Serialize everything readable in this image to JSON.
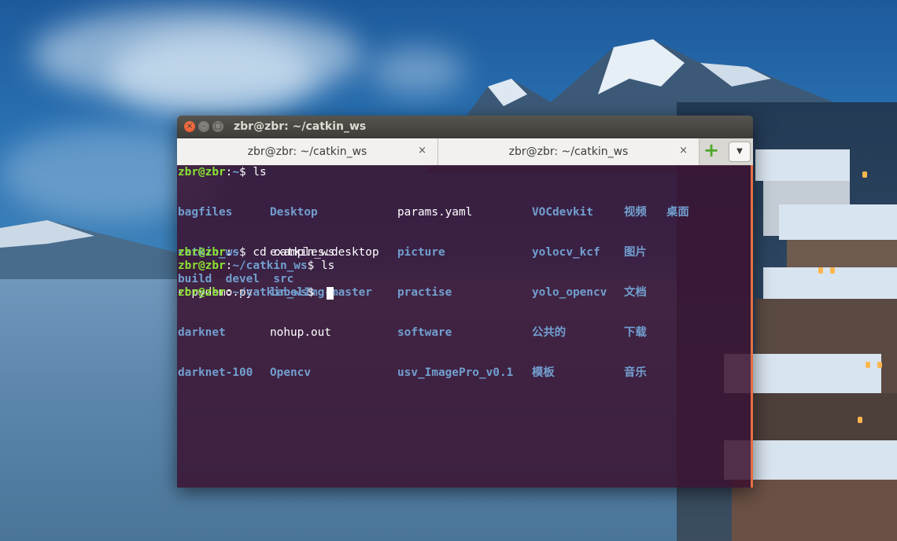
{
  "window": {
    "title": "zbr@zbr: ~/catkin_ws",
    "close_icon": "×",
    "minimize_icon": "–",
    "maximize_icon": "□"
  },
  "tabs": [
    {
      "label": "zbr@zbr: ~/catkin_ws",
      "close": "×"
    },
    {
      "label": "zbr@zbr: ~/catkin_ws",
      "close": "×"
    }
  ],
  "tabbar": {
    "new_tab_icon": "+",
    "menu_icon": "▼"
  },
  "terminal": {
    "user_host": "zbr@zbr",
    "colon": ":",
    "prompt_home": "~",
    "prompt_ws": "~/catkin_ws",
    "dollar": "$",
    "cmd1": " ls",
    "cmd2": " cd catkin_ws",
    "cmd3": " ls",
    "ls_home": {
      "col1": [
        "bagfiles",
        "catkin_ws",
        "copydemo.py",
        "darknet",
        "darknet-100"
      ],
      "col2": [
        "Desktop",
        "examples.desktop",
        "labelImg-master",
        "nohup.out",
        "Opencv"
      ],
      "col3": [
        "params.yaml",
        "picture",
        "practise",
        "software",
        "usv_ImagePro_v0.1"
      ],
      "col4": [
        "VOCdevkit",
        "yolocv_kcf",
        "yolo_opencv",
        "公共的",
        "模板"
      ],
      "col5": [
        "视频",
        "图片",
        "文档",
        "下载",
        "音乐"
      ],
      "col6": [
        "桌面"
      ]
    },
    "ls_ws": [
      "build",
      "devel",
      "src"
    ]
  },
  "colors": {
    "prompt_green": "#8ae234",
    "dir_blue": "#729fcf",
    "terminal_bg": "#3a1230",
    "accent_orange": "#e46f45"
  }
}
